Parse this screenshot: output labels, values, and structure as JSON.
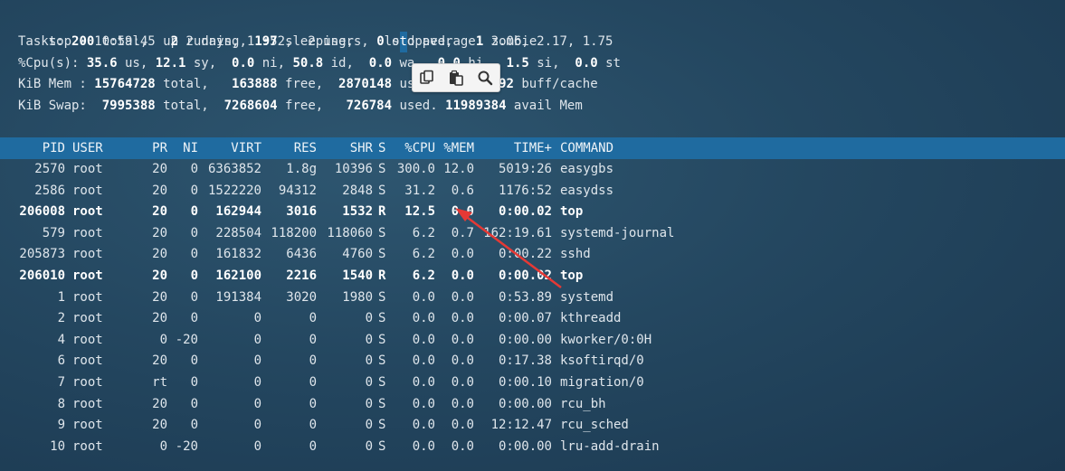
{
  "summary": {
    "top": [
      "top - 10:59:45 up 2 days, 11:52,  2 users,  load average: 3.06, 2.17, 1.75"
    ],
    "tasks": {
      "pre": "Tasks: ",
      "total": "200",
      "t1": " total,   ",
      "running": "2",
      "t2": " running, ",
      "sleeping": "197",
      "t3": " sleeping,   ",
      "stopped": "0",
      "t4a": " s",
      "t4b": "t",
      "t4c": "opped,   ",
      "zombie": "1",
      "t5": " zombie"
    },
    "cpu": {
      "pre": "%Cpu(s): ",
      "us": "35.6",
      "t1": " us, ",
      "sy": "12.1",
      "t2": " sy,  ",
      "ni": "0.0",
      "t3": " ni, ",
      "id": "50.8",
      "t4": " id,  ",
      "wa": "0.0",
      "t5": " wa,  ",
      "hi": "0.0",
      "t6": " hi,  ",
      "si": "1.5",
      "t7": " si,  ",
      "st": "0.0",
      "t8": " st"
    },
    "mem": {
      "pre": "KiB Mem : ",
      "total": "15764728",
      "t1": " total,   ",
      "free": "163888",
      "t2": " free,  ",
      "used": "2870148",
      "t3": " used,  ",
      "buff": "12730692",
      "t4": " buff/cache"
    },
    "swap": {
      "pre": "KiB Swap:  ",
      "total": "7995388",
      "t1": " total,  ",
      "free": "7268604",
      "t2": " free,   ",
      "used": "726784",
      "t3": " used. ",
      "avail": "11989384",
      "t4": " avail Mem"
    }
  },
  "columns": [
    "PID",
    "USER",
    "PR",
    "NI",
    "VIRT",
    "RES",
    "SHR",
    "S",
    "%CPU",
    "%MEM",
    "TIME+",
    "COMMAND"
  ],
  "processes": [
    {
      "pid": "2570",
      "user": "root",
      "pr": "20",
      "ni": "0",
      "virt": "6363852",
      "res": "1.8g",
      "shr": "10396",
      "s": "S",
      "cpu": "300.0",
      "mem": "12.0",
      "time": "5019:26",
      "cmd": "easygbs",
      "bold": false
    },
    {
      "pid": "2586",
      "user": "root",
      "pr": "20",
      "ni": "0",
      "virt": "1522220",
      "res": "94312",
      "shr": "2848",
      "s": "S",
      "cpu": "31.2",
      "mem": "0.6",
      "time": "1176:52",
      "cmd": "easydss",
      "bold": false
    },
    {
      "pid": "206008",
      "user": "root",
      "pr": "20",
      "ni": "0",
      "virt": "162944",
      "res": "3016",
      "shr": "1532",
      "s": "R",
      "cpu": "12.5",
      "mem": "0.0",
      "time": "0:00.02",
      "cmd": "top",
      "bold": true
    },
    {
      "pid": "579",
      "user": "root",
      "pr": "20",
      "ni": "0",
      "virt": "228504",
      "res": "118200",
      "shr": "118060",
      "s": "S",
      "cpu": "6.2",
      "mem": "0.7",
      "time": "162:19.61",
      "cmd": "systemd-journal",
      "bold": false
    },
    {
      "pid": "205873",
      "user": "root",
      "pr": "20",
      "ni": "0",
      "virt": "161832",
      "res": "6436",
      "shr": "4760",
      "s": "S",
      "cpu": "6.2",
      "mem": "0.0",
      "time": "0:00.22",
      "cmd": "sshd",
      "bold": false
    },
    {
      "pid": "206010",
      "user": "root",
      "pr": "20",
      "ni": "0",
      "virt": "162100",
      "res": "2216",
      "shr": "1540",
      "s": "R",
      "cpu": "6.2",
      "mem": "0.0",
      "time": "0:00.02",
      "cmd": "top",
      "bold": true
    },
    {
      "pid": "1",
      "user": "root",
      "pr": "20",
      "ni": "0",
      "virt": "191384",
      "res": "3020",
      "shr": "1980",
      "s": "S",
      "cpu": "0.0",
      "mem": "0.0",
      "time": "0:53.89",
      "cmd": "systemd",
      "bold": false
    },
    {
      "pid": "2",
      "user": "root",
      "pr": "20",
      "ni": "0",
      "virt": "0",
      "res": "0",
      "shr": "0",
      "s": "S",
      "cpu": "0.0",
      "mem": "0.0",
      "time": "0:00.07",
      "cmd": "kthreadd",
      "bold": false
    },
    {
      "pid": "4",
      "user": "root",
      "pr": "0",
      "ni": "-20",
      "virt": "0",
      "res": "0",
      "shr": "0",
      "s": "S",
      "cpu": "0.0",
      "mem": "0.0",
      "time": "0:00.00",
      "cmd": "kworker/0:0H",
      "bold": false
    },
    {
      "pid": "6",
      "user": "root",
      "pr": "20",
      "ni": "0",
      "virt": "0",
      "res": "0",
      "shr": "0",
      "s": "S",
      "cpu": "0.0",
      "mem": "0.0",
      "time": "0:17.38",
      "cmd": "ksoftirqd/0",
      "bold": false
    },
    {
      "pid": "7",
      "user": "root",
      "pr": "rt",
      "ni": "0",
      "virt": "0",
      "res": "0",
      "shr": "0",
      "s": "S",
      "cpu": "0.0",
      "mem": "0.0",
      "time": "0:00.10",
      "cmd": "migration/0",
      "bold": false
    },
    {
      "pid": "8",
      "user": "root",
      "pr": "20",
      "ni": "0",
      "virt": "0",
      "res": "0",
      "shr": "0",
      "s": "S",
      "cpu": "0.0",
      "mem": "0.0",
      "time": "0:00.00",
      "cmd": "rcu_bh",
      "bold": false
    },
    {
      "pid": "9",
      "user": "root",
      "pr": "20",
      "ni": "0",
      "virt": "0",
      "res": "0",
      "shr": "0",
      "s": "S",
      "cpu": "0.0",
      "mem": "0.0",
      "time": "12:12.47",
      "cmd": "rcu_sched",
      "bold": false
    },
    {
      "pid": "10",
      "user": "root",
      "pr": "0",
      "ni": "-20",
      "virt": "0",
      "res": "0",
      "shr": "0",
      "s": "S",
      "cpu": "0.0",
      "mem": "0.0",
      "time": "0:00.00",
      "cmd": "lru-add-drain",
      "bold": false
    }
  ],
  "toolbar": {
    "icons": [
      "copy-icon",
      "paste-icon",
      "search-icon"
    ]
  },
  "colors": {
    "header_bar": "#1f6ba0",
    "arrow": "#e53935"
  }
}
